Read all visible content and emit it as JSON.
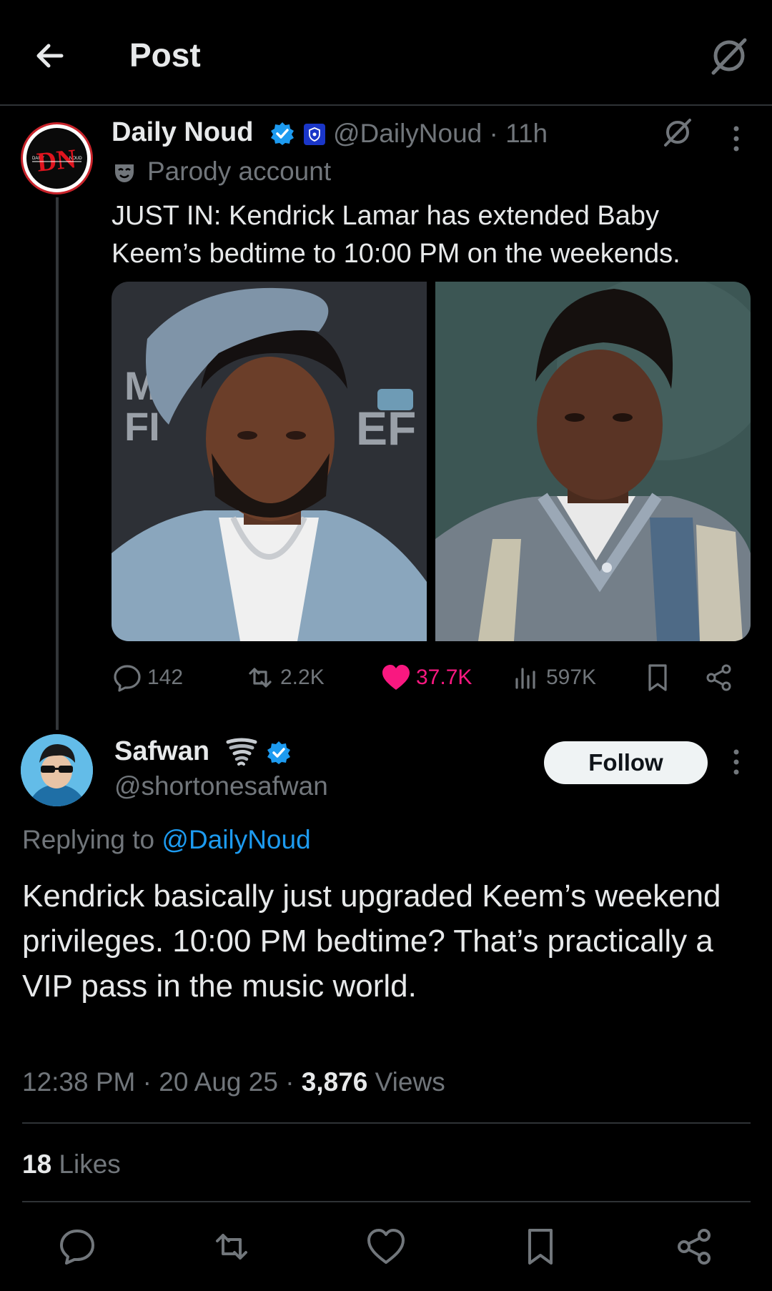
{
  "header": {
    "title": "Post",
    "back_icon": "arrow-left-icon",
    "grok_icon": "grok-icon"
  },
  "original_post": {
    "author_name": "Daily Noud",
    "handle_time": "@DailyNoud · 11h",
    "label": "Parody account",
    "text": "JUST IN: Kendrick Lamar has extended Baby Keem’s bedtime to 10:00 PM on the weekends.",
    "avatar_text": {
      "top_left": "DAILY",
      "top_right": "NOUD",
      "monogram": "DN"
    },
    "images": [
      {
        "sign_text_1": "M",
        "sign_text_2": "FI",
        "sign_text_3": "EF"
      }
    ],
    "stats": {
      "replies": "142",
      "reposts": "2.2K",
      "likes": "37.7K",
      "views": "597K"
    }
  },
  "reply": {
    "author_name": "Safwan",
    "handle": "@shortonesafwan",
    "follow_label": "Follow",
    "replying_prefix": "Replying to ",
    "replying_to": "@DailyNoud",
    "text": "Kendrick basically just upgraded Keem’s weekend privileges. 10:00 PM bedtime? That’s practically a VIP pass in the music world.",
    "timestamp": "12:38 PM · 20 Aug 25 · ",
    "views_count": "3,876",
    "views_label": " Views",
    "likes_count": "18",
    "likes_label": " Likes"
  },
  "colors": {
    "background": "#000000",
    "text_primary": "#e7e9ea",
    "text_secondary": "#71767b",
    "accent_blue": "#1d9bf0",
    "like_pink": "#f91880",
    "divider": "#2f3336"
  }
}
